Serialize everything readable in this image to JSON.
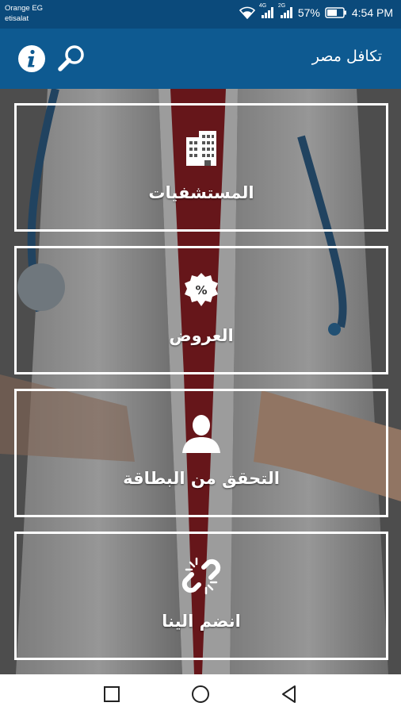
{
  "status_bar": {
    "carrier_1": "Orange EG",
    "carrier_2": "etisalat",
    "network_1": "4G",
    "network_2": "2G",
    "battery": "57%",
    "time": "4:54 PM"
  },
  "app_bar": {
    "title": "تكافل مصر",
    "info_icon": "info-icon",
    "search_icon": "search-icon",
    "color": "#0e5a91"
  },
  "menu": {
    "items": [
      {
        "label": "المستشفيات",
        "icon": "hospital-icon"
      },
      {
        "label": "العروض",
        "icon": "percent-badge-icon"
      },
      {
        "label": "التحقق من البطاقة",
        "icon": "user-icon"
      },
      {
        "label": "انضم الينا",
        "icon": "broken-link-icon"
      }
    ]
  },
  "nav_bar": {
    "buttons": [
      "recent-apps-icon",
      "home-icon",
      "back-icon"
    ]
  }
}
